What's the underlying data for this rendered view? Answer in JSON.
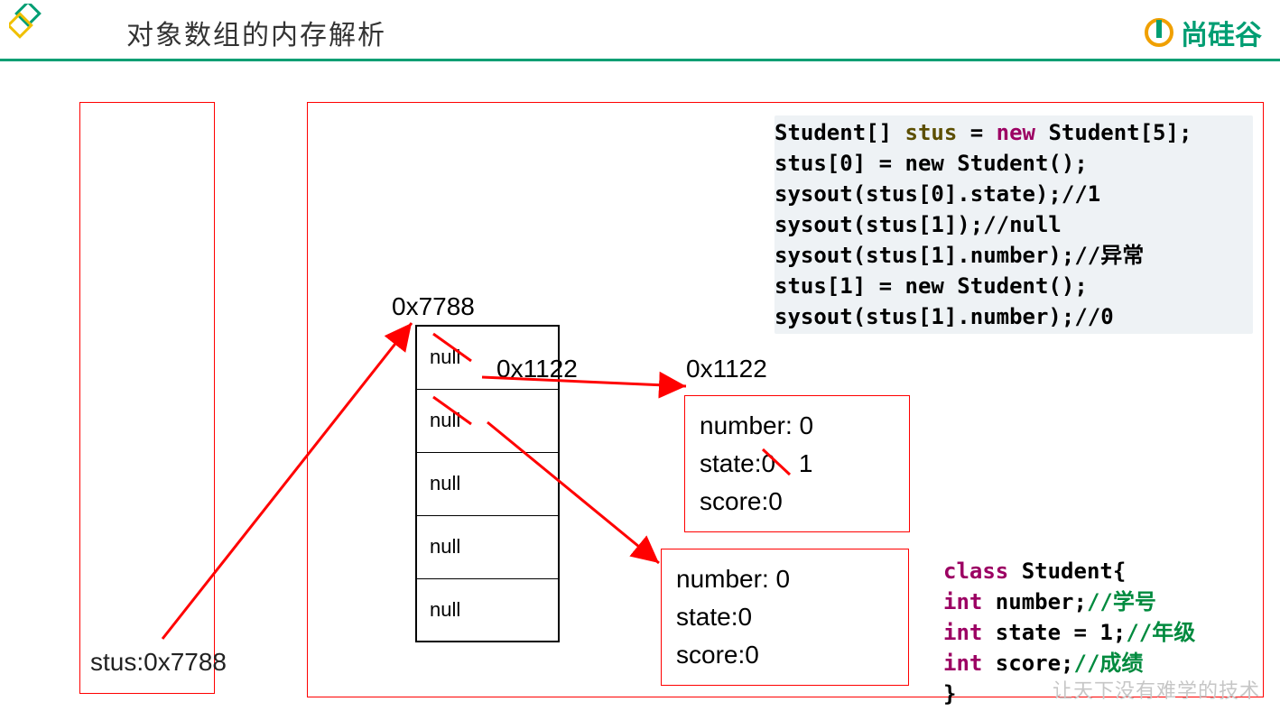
{
  "title": "对象数组的内存解析",
  "brand": "尚硅谷",
  "watermark": "让天下没有难学的技术",
  "stack": {
    "label": "stus:0x7788"
  },
  "array": {
    "addr": "0x7788",
    "sideAddr": "0x1122",
    "cells": [
      "null",
      "null",
      "null",
      "null",
      "null"
    ]
  },
  "obj1": {
    "addr": "0x1122",
    "number": "number: 0",
    "state": "state:0",
    "stateNew": "  1",
    "score": "score:0"
  },
  "obj2": {
    "number": "number: 0",
    "state": "state:0",
    "score": "score:0"
  },
  "codeTop": {
    "l1a": "Student[] ",
    "l1b": "stus",
    "l1c": " = ",
    "l1d": "new",
    "l1e": " Student[5];",
    "l2": "stus[0] = new Student();",
    "l3": "sysout(stus[0].state);//1",
    "l4": "sysout(stus[1]);//null",
    "l5": "sysout(stus[1].number);//异常",
    "l6": "stus[1] = new Student();",
    "l7": "sysout(stus[1].number);//0"
  },
  "codeClass": {
    "l1a": "class",
    "l1b": " Student{",
    "l2a": "int",
    "l2b": " number;",
    "l2c": "//学号",
    "l3a": "int",
    "l3b": " state = 1;",
    "l3c": "//年级",
    "l4a": "int",
    "l4b": " score;",
    "l4c": "//成绩",
    "l5": "}"
  }
}
